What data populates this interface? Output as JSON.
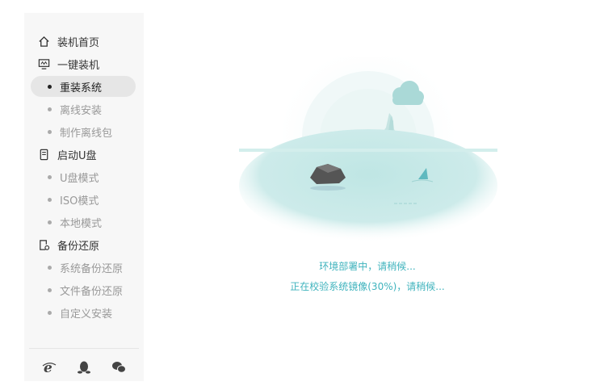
{
  "sidebar": {
    "items": [
      {
        "label": "装机首页",
        "type": "section",
        "icon": "home-icon"
      },
      {
        "label": "一键装机",
        "type": "section",
        "icon": "monitor-icon"
      },
      {
        "label": "重装系统",
        "type": "sub",
        "active": true
      },
      {
        "label": "离线安装",
        "type": "sub"
      },
      {
        "label": "制作离线包",
        "type": "sub"
      },
      {
        "label": "启动U盘",
        "type": "section",
        "icon": "usb-drive-icon"
      },
      {
        "label": "U盘模式",
        "type": "sub"
      },
      {
        "label": "ISO模式",
        "type": "sub"
      },
      {
        "label": "本地模式",
        "type": "sub"
      },
      {
        "label": "备份还原",
        "type": "section",
        "icon": "backup-restore-icon"
      },
      {
        "label": "系统备份还原",
        "type": "sub"
      },
      {
        "label": "文件备份还原",
        "type": "sub"
      },
      {
        "label": "自定义安装",
        "type": "sub"
      }
    ],
    "footer_icons": [
      "ie-browser-icon",
      "qq-penguin-icon",
      "wechat-icon"
    ]
  },
  "status": {
    "line1": "环境部署中，请稍候...",
    "line2": "正在校验系统镜像(30%)，请稍候..."
  },
  "colors": {
    "accent": "#3fb3bd",
    "sidebar_bg": "#f7f7f7",
    "active_bg": "#e6e6e6",
    "water": "#bfe6e4"
  }
}
